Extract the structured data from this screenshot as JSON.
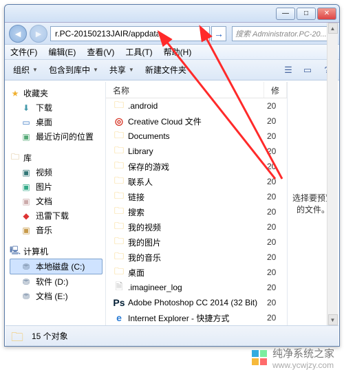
{
  "window": {
    "min_glyph": "—",
    "max_glyph": "□",
    "close_glyph": "✕"
  },
  "nav": {
    "back_glyph": "◄",
    "fwd_glyph": "►",
    "address": "r.PC-20150213JAIR/appdata",
    "drop_glyph": "▼",
    "go_glyph": "→",
    "search_placeholder": "搜索 Administrator.PC-20..."
  },
  "menu": {
    "file": "文件(F)",
    "edit": "编辑(E)",
    "view": "查看(V)",
    "tools": "工具(T)",
    "help": "帮助(H)"
  },
  "toolbar": {
    "organize": "组织",
    "include": "包含到库中",
    "share": "共享",
    "newfolder": "新建文件夹",
    "drop": "▼",
    "icon_view": "☰",
    "icon_preview": "▭",
    "icon_help": "?"
  },
  "navpane": {
    "favorites": "收藏夹",
    "downloads": "下载",
    "desktop": "桌面",
    "recent": "最近访问的位置",
    "libraries": "库",
    "videos": "视频",
    "pictures": "图片",
    "documents": "文档",
    "thunder": "迅雷下载",
    "music": "音乐",
    "computer": "计算机",
    "disk_c": "本地磁盘 (C:)",
    "disk_d": "软件 (D:)",
    "disk_e": "文档 (E:)"
  },
  "listhead": {
    "name": "名称",
    "date": "修"
  },
  "items": [
    {
      "icon": "folder",
      "name": ".android",
      "date": "20"
    },
    {
      "icon": "cc",
      "name": "Creative Cloud 文件",
      "date": "20"
    },
    {
      "icon": "folder",
      "name": "Documents",
      "date": "20"
    },
    {
      "icon": "folder",
      "name": "Library",
      "date": "20"
    },
    {
      "icon": "folder",
      "name": "保存的游戏",
      "date": "20"
    },
    {
      "icon": "folder",
      "name": "联系人",
      "date": "20"
    },
    {
      "icon": "folder",
      "name": "链接",
      "date": "20"
    },
    {
      "icon": "folder",
      "name": "搜索",
      "date": "20"
    },
    {
      "icon": "folder",
      "name": "我的视频",
      "date": "20"
    },
    {
      "icon": "folder",
      "name": "我的图片",
      "date": "20"
    },
    {
      "icon": "folder",
      "name": "我的音乐",
      "date": "20"
    },
    {
      "icon": "folder",
      "name": "桌面",
      "date": "20"
    },
    {
      "icon": "file",
      "name": ".imagineer_log",
      "date": "20"
    },
    {
      "icon": "ps",
      "name": "Adobe Photoshop CC 2014 (32 Bit)",
      "date": "20"
    },
    {
      "icon": "ie",
      "name": "Internet Explorer - 快捷方式",
      "date": "20"
    }
  ],
  "preview": {
    "text": "选择要预览的文件。"
  },
  "status": {
    "count": "15 个对象"
  },
  "watermark": {
    "brand": "纯净系统之家",
    "url": "www.ycwjzy.com"
  }
}
